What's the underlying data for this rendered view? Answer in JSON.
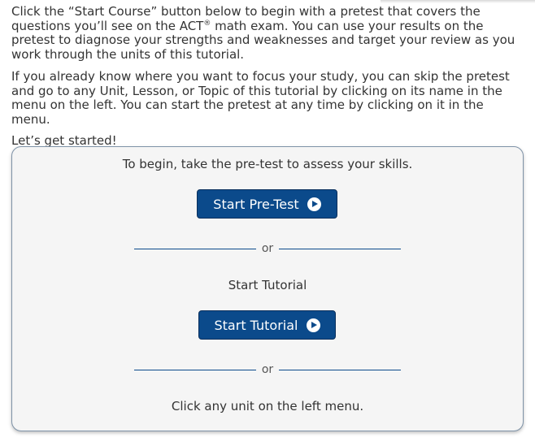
{
  "intro": {
    "p1_before": "Click the “Start Course” button below to begin with a pretest that covers the questions you’ll see on the ACT",
    "p1_reg": "®",
    "p1_after": " math exam. You can use your results on the pretest to diagnose your strengths and weaknesses and target your review as you work through the units of this tutorial.",
    "p2": "If you already know where you want to focus your study, you can skip the pretest and go to any Unit, Lesson, or Topic of this tutorial by clicking on its name in the menu on the left. You can start the pretest at any time by clicking on it in the menu.",
    "p3": "Let’s get started!"
  },
  "panel": {
    "pretest_prompt": "To begin, take the pre-test to assess your skills.",
    "start_pretest_label": "Start Pre-Test",
    "or_1": "or",
    "tutorial_heading": "Start Tutorial",
    "start_tutorial_label": "Start Tutorial",
    "or_2": "or",
    "menu_hint": "Click any unit on the left menu."
  },
  "colors": {
    "button_bg": "#0b4a8b",
    "panel_bg": "#f5f5f5",
    "panel_border": "#7f93a8",
    "text": "#333333"
  },
  "icons": {
    "button_icon": "play-circle-icon"
  }
}
